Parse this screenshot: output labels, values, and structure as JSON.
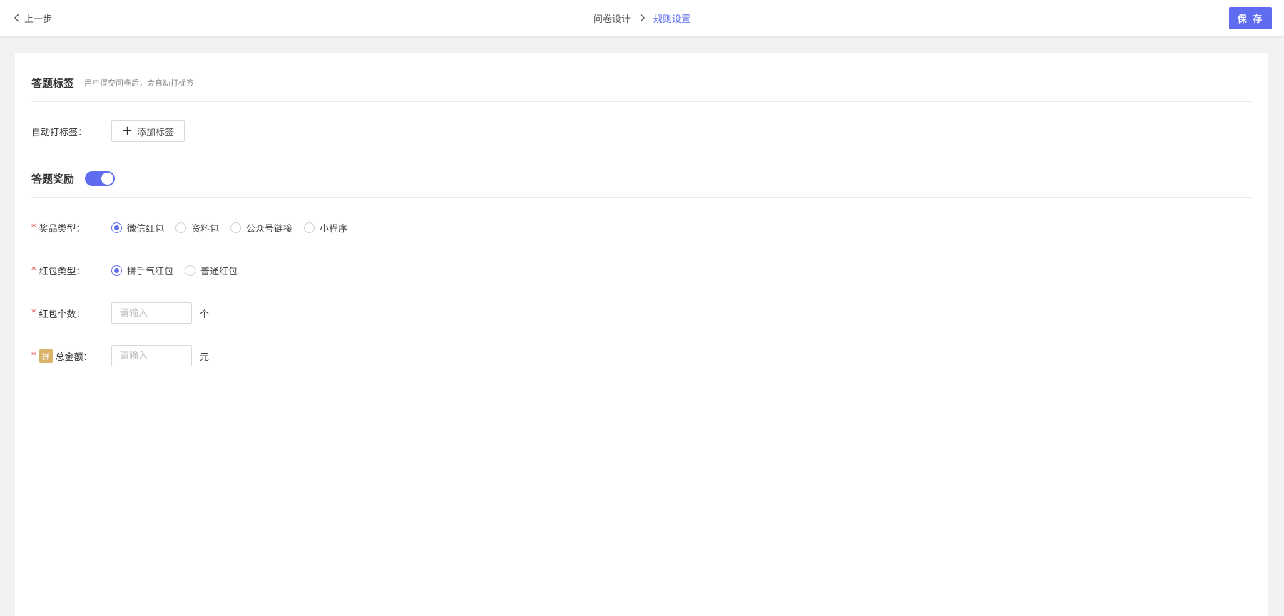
{
  "header": {
    "back_label": "上一步",
    "breadcrumb": [
      "问卷设计",
      "规则设置"
    ],
    "save_label": "保 存"
  },
  "tag_section": {
    "title": "答题标签",
    "subtitle": "用户提交问卷后，会自动打标签",
    "auto_tag_label": "自动打标签：",
    "add_tag_button": "添加标签"
  },
  "reward_section": {
    "title": "答题奖励",
    "enabled": true,
    "prize_type": {
      "label": "奖品类型：",
      "options": [
        "微信红包",
        "资料包",
        "公众号链接",
        "小程序"
      ],
      "selected": "微信红包"
    },
    "redpack_type": {
      "label": "红包类型：",
      "options": [
        "拼手气红包",
        "普通红包"
      ],
      "selected": "拼手气红包"
    },
    "redpack_count": {
      "label": "红包个数：",
      "value": "",
      "placeholder": "请输入",
      "unit": "个"
    },
    "total_amount": {
      "badge": "拼",
      "label": "总金额：",
      "value": "",
      "placeholder": "请输入",
      "unit": "元"
    }
  },
  "colors": {
    "accent": "#5f6cf0",
    "required": "#e4393c",
    "badge": "#d9b36a"
  }
}
